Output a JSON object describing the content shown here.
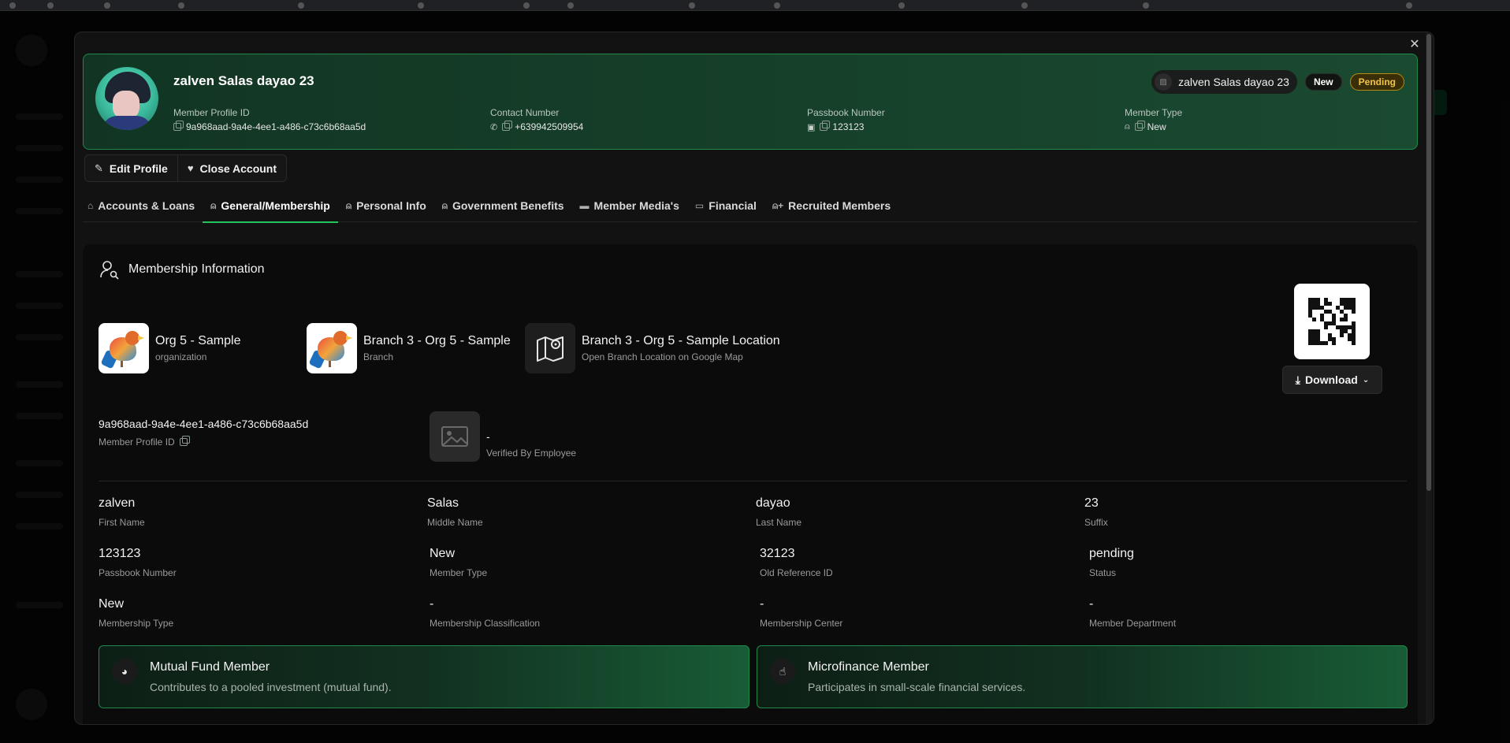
{
  "header": {
    "name": "zalven Salas dayao 23",
    "profile_id_label": "Member Profile ID",
    "profile_id": "9a968aad-9a4e-4ee1-a486-c73c6b68aa5d",
    "contact_label": "Contact Number",
    "contact": "+639942509954",
    "passbook_label": "Passbook Number",
    "passbook": "123123",
    "member_type_label": "Member Type",
    "member_type": "New",
    "chip_name": "zalven Salas dayao 23",
    "badge_new": "New",
    "badge_status": "Pending"
  },
  "actions": {
    "edit": "Edit Profile",
    "close": "Close Account"
  },
  "tabs": [
    {
      "label": "Accounts & Loans",
      "icon": "bank-icon"
    },
    {
      "label": "General/Membership",
      "icon": "user-badge-icon",
      "active": true
    },
    {
      "label": "Personal Info",
      "icon": "user-icon"
    },
    {
      "label": "Government Benefits",
      "icon": "user-gear-icon"
    },
    {
      "label": "Member Media's",
      "icon": "folder-icon"
    },
    {
      "label": "Financial",
      "icon": "card-icon"
    },
    {
      "label": "Recruited Members",
      "icon": "user-plus-icon"
    }
  ],
  "section": {
    "title": "Membership Information",
    "org": {
      "name": "Org 5 - Sample",
      "sub": "organization"
    },
    "branch": {
      "name": "Branch 3 - Org 5 - Sample",
      "sub": "Branch"
    },
    "location": {
      "name": "Branch 3 - Org 5 - Sample Location",
      "sub": "Open Branch Location on Google Map"
    },
    "download": "Download",
    "profile_id": "9a968aad-9a4e-4ee1-a486-c73c6b68aa5d",
    "profile_id_label": "Member Profile ID",
    "verified_value": "-",
    "verified_label": "Verified By Employee"
  },
  "fields": {
    "first_name": {
      "v": "zalven",
      "l": "First Name"
    },
    "middle_name": {
      "v": "Salas",
      "l": "Middle Name"
    },
    "last_name": {
      "v": "dayao",
      "l": "Last Name"
    },
    "suffix": {
      "v": "23",
      "l": "Suffix"
    },
    "passbook": {
      "v": "123123",
      "l": "Passbook Number"
    },
    "member_type": {
      "v": "New",
      "l": "Member Type"
    },
    "old_ref": {
      "v": "32123",
      "l": "Old Reference ID"
    },
    "status": {
      "v": "pending",
      "l": "Status"
    },
    "membership_type": {
      "v": "New",
      "l": "Membership Type"
    },
    "classification": {
      "v": "-",
      "l": "Membership Classification"
    },
    "center": {
      "v": "-",
      "l": "Membership Center"
    },
    "department": {
      "v": "-",
      "l": "Member Department"
    }
  },
  "flags": {
    "mutual": {
      "title": "Mutual Fund Member",
      "desc": "Contributes to a pooled investment (mutual fund)."
    },
    "micro": {
      "title": "Microfinance Member",
      "desc": "Participates in small-scale financial services."
    }
  },
  "colors": {
    "accent": "#22c55e",
    "pending": "#f3c443"
  }
}
